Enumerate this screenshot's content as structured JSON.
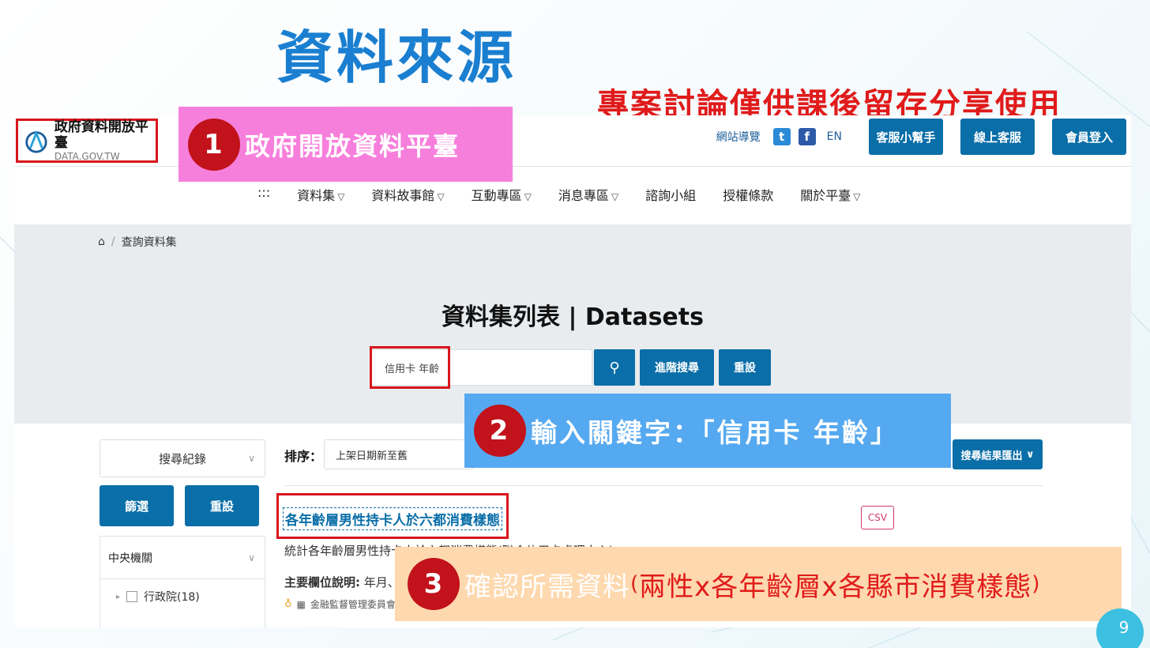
{
  "slide": {
    "title": "資料來源",
    "note": "專案討論僅供課後留存分享使用",
    "page_number": "9"
  },
  "site": {
    "logo_name": "政府資料開放平臺",
    "logo_sub": "DATA.GOV.TW",
    "top_links": {
      "sitemap": "網站導覽",
      "twitter_icon": "twitter-icon",
      "facebook_icon": "facebook-icon",
      "lang": "EN",
      "help_btn": "客服小幫手",
      "online_btn": "線上客服",
      "login_btn": "會員登入"
    },
    "nav": {
      "menu_icon": ":::",
      "items": [
        {
          "label": "資料集",
          "dropdown": true
        },
        {
          "label": "資料故事館",
          "dropdown": true
        },
        {
          "label": "互動專區",
          "dropdown": true
        },
        {
          "label": "消息專區",
          "dropdown": true
        },
        {
          "label": "諮詢小組",
          "dropdown": false
        },
        {
          "label": "授權條款",
          "dropdown": false
        },
        {
          "label": "關於平臺",
          "dropdown": true
        }
      ]
    }
  },
  "hero": {
    "breadcrumb_current": "查詢資料集",
    "title": "資料集列表 | Datasets",
    "search_value": "信用卡 年齡",
    "advanced_btn": "進階搜尋",
    "reset_btn": "重設"
  },
  "sidebar": {
    "history_label": "搜尋紀錄",
    "filter_btn": "篩選",
    "reset_btn": "重設",
    "group_label": "中央機關",
    "group_items": [
      {
        "label": "行政院(18)"
      }
    ]
  },
  "results": {
    "sort_label": "排序：",
    "sort_value": "上架日期新至舊",
    "export_btn": "搜尋結果匯出",
    "item": {
      "title": "各年齡層男性持卡人於六都消費樣態",
      "format": "CSV",
      "description": "統計各年齡層男性持卡人於六都消費樣態(聯合信用卡處理中心)",
      "fields_label": "主要欄位說明:",
      "fields_value": "年月、",
      "org": "金融監督管理委員會銀行局"
    }
  },
  "callouts": {
    "c1": {
      "num": "1",
      "text": "政府開放資料平臺"
    },
    "c2": {
      "num": "2",
      "text": "輸入關鍵字：「信用卡 年齡」"
    },
    "c3": {
      "num": "3",
      "text_main": "確認所需資料",
      "paren_open": "(",
      "text_detail": "兩性x各年齡層x各縣市消費樣態",
      "paren_close": ")"
    }
  },
  "colors": {
    "accent_blue": "#0a6ea8",
    "highlight_red": "#d7161d",
    "callout_pink": "#f77fdc",
    "callout_blue": "#55a9f0",
    "callout_peach": "#fed8ae"
  }
}
